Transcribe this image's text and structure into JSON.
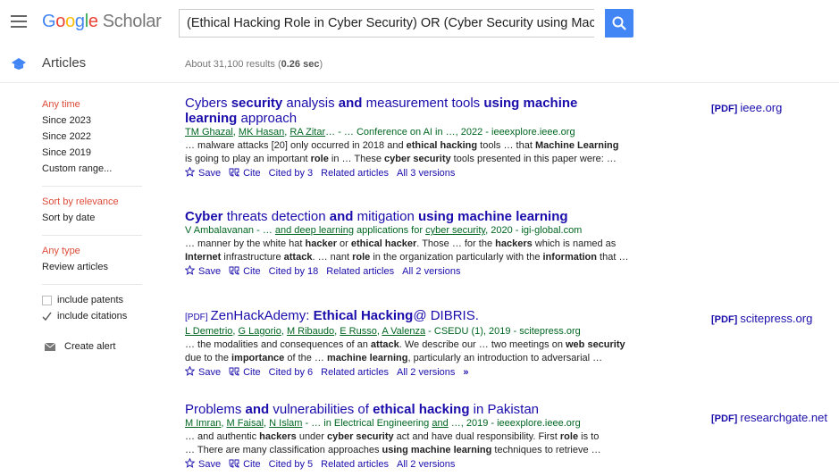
{
  "header": {
    "logo_google": "Google",
    "logo_scholar": "Scholar",
    "search_value": "(Ethical Hacking Role in Cyber Security) OR (Cyber Security using Machine L"
  },
  "subheader": {
    "section_label": "Articles",
    "results_prefix": "About 31,100 results (",
    "results_time": "0.26 sec",
    "results_suffix": ")"
  },
  "sidebar": {
    "time_filters": [
      "Any time",
      "Since 2023",
      "Since 2022",
      "Since 2019",
      "Custom range..."
    ],
    "sort_options": [
      "Sort by relevance",
      "Sort by date"
    ],
    "type_options": [
      "Any type",
      "Review articles"
    ],
    "include_patents": "include patents",
    "include_citations": "include citations",
    "create_alert": "Create alert"
  },
  "results": [
    {
      "title_parts": [
        [
          "Cybers ",
          false
        ],
        [
          "security",
          true
        ],
        [
          " analysis ",
          false
        ],
        [
          "and",
          true
        ],
        [
          " measurement tools ",
          false
        ],
        [
          "using machine learning",
          true
        ],
        [
          " approach",
          false
        ]
      ],
      "authors": [
        [
          "TM Ghazal",
          true
        ],
        [
          ", ",
          false
        ],
        [
          "MK Hasan",
          true
        ],
        [
          ", ",
          false
        ],
        [
          "RA Zitar",
          true
        ],
        [
          "… - … Conference on AI in …, 2022 - ieeexplore.ieee.org",
          false
        ]
      ],
      "snippet_lines": [
        [
          [
            "… malware attacks [20] only occurred in 2018 and ",
            false
          ],
          [
            "ethical hacking",
            true
          ],
          [
            " tools … that ",
            false
          ],
          [
            "Machine Learning",
            true
          ]
        ],
        [
          [
            "is going to play an important ",
            false
          ],
          [
            "role",
            true
          ],
          [
            " in … These ",
            false
          ],
          [
            "cyber security",
            true
          ],
          [
            " tools presented in this paper were: …",
            false
          ]
        ]
      ],
      "save": "Save",
      "cite": "Cite",
      "cited_by": "Cited by 3",
      "related": "Related articles",
      "versions": "All 3 versions",
      "pdf_label": "[PDF]",
      "pdf_source": "ieee.org"
    },
    {
      "title_parts": [
        [
          "Cyber",
          true
        ],
        [
          " threats detection ",
          false
        ],
        [
          "and",
          true
        ],
        [
          " mitigation ",
          false
        ],
        [
          "using machine learning",
          true
        ]
      ],
      "authors": [
        [
          "V Ambalavanan - … ",
          false
        ],
        [
          "and deep learning",
          true
        ],
        [
          " applications for ",
          false
        ],
        [
          "cyber security",
          true
        ],
        [
          ", 2020 - igi-global.com",
          false
        ]
      ],
      "snippet_lines": [
        [
          [
            "… manner by the white hat ",
            false
          ],
          [
            "hacker",
            true
          ],
          [
            " or ",
            false
          ],
          [
            "ethical hacker",
            true
          ],
          [
            ". Those … for the ",
            false
          ],
          [
            "hackers",
            true
          ],
          [
            " which is named as",
            false
          ]
        ],
        [
          [
            "Internet",
            true
          ],
          [
            " infrastructure ",
            false
          ],
          [
            "attack",
            true
          ],
          [
            ". … nant ",
            false
          ],
          [
            "role",
            true
          ],
          [
            " in the organization particularly with the ",
            false
          ],
          [
            "information",
            true
          ],
          [
            " that …",
            false
          ]
        ]
      ],
      "save": "Save",
      "cite": "Cite",
      "cited_by": "Cited by 18",
      "related": "Related articles",
      "versions": "All 2 versions"
    },
    {
      "pdf_prefix": "[PDF]",
      "title_parts": [
        [
          "ZenHackAdemy: ",
          false
        ],
        [
          "Ethical Hacking",
          true
        ],
        [
          "@ DIBRIS.",
          false
        ]
      ],
      "authors": [
        [
          "L Demetrio",
          true
        ],
        [
          ", ",
          false
        ],
        [
          "G Lagorio",
          true
        ],
        [
          ", ",
          false
        ],
        [
          "M Ribaudo",
          true
        ],
        [
          ", ",
          false
        ],
        [
          "E Russo",
          true
        ],
        [
          ", ",
          false
        ],
        [
          "A Valenza",
          true
        ],
        [
          " - CSEDU (1), 2019 - scitepress.org",
          false
        ]
      ],
      "snippet_lines": [
        [
          [
            "… the modalities and consequences of an ",
            false
          ],
          [
            "attack",
            true
          ],
          [
            ". We describe our … two meetings on ",
            false
          ],
          [
            "web security",
            true
          ]
        ],
        [
          [
            "due to the ",
            false
          ],
          [
            "importance",
            true
          ],
          [
            " of the … ",
            false
          ],
          [
            "machine learning",
            true
          ],
          [
            ", particularly an introduction to adversarial …",
            false
          ]
        ]
      ],
      "save": "Save",
      "cite": "Cite",
      "cited_by": "Cited by 6",
      "related": "Related articles",
      "versions": "All 2 versions",
      "more": "»",
      "pdf_label": "[PDF]",
      "pdf_source": "scitepress.org"
    },
    {
      "title_parts": [
        [
          "Problems ",
          false
        ],
        [
          "and",
          true
        ],
        [
          " vulnerabilities of ",
          false
        ],
        [
          "ethical hacking",
          true
        ],
        [
          " in Pakistan",
          false
        ]
      ],
      "authors": [
        [
          "M Imran",
          true
        ],
        [
          ", ",
          false
        ],
        [
          "M Faisal",
          true
        ],
        [
          ", ",
          false
        ],
        [
          "N Islam",
          true
        ],
        [
          " - … in Electrical Engineering ",
          false
        ],
        [
          "and",
          true
        ],
        [
          " …, 2019 - ieeexplore.ieee.org",
          false
        ]
      ],
      "snippet_lines": [
        [
          [
            "… and authentic ",
            false
          ],
          [
            "hackers",
            true
          ],
          [
            " under ",
            false
          ],
          [
            "cyber security",
            true
          ],
          [
            " act and have dual responsibility. First ",
            false
          ],
          [
            "role",
            true
          ],
          [
            " is to",
            false
          ]
        ],
        [
          [
            "… There are many classification approaches ",
            false
          ],
          [
            "using machine learning",
            true
          ],
          [
            " techniques to retrieve …",
            false
          ]
        ]
      ],
      "save": "Save",
      "cite": "Cite",
      "cited_by": "Cited by 5",
      "related": "Related articles",
      "versions": "All 2 versions",
      "pdf_label": "[PDF]",
      "pdf_source": "researchgate.net"
    }
  ]
}
